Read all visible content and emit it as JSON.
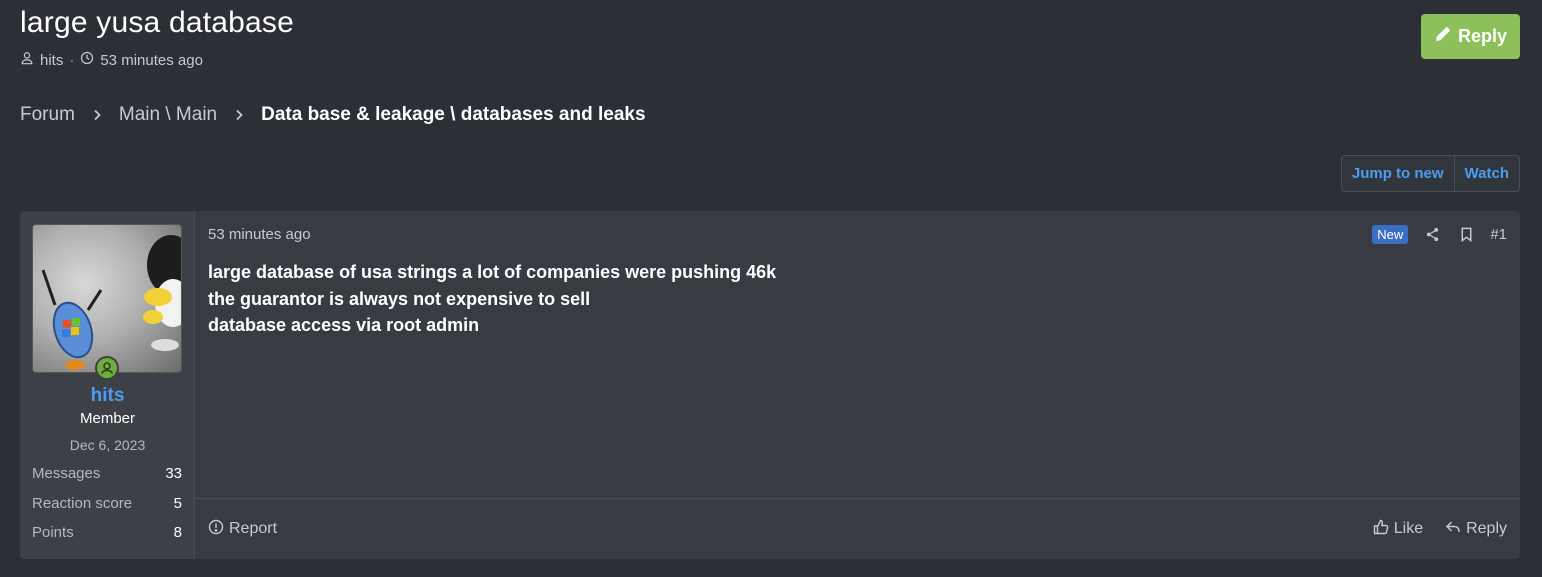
{
  "thread": {
    "title": "large yusa database",
    "author": "hits",
    "separator": "·",
    "time_ago": "53 minutes ago",
    "reply_label": "Reply"
  },
  "breadcrumb": {
    "items": [
      "Forum",
      "Main \\ Main"
    ],
    "current": "Data base & leakage \\ databases and leaks"
  },
  "thread_actions": {
    "jump_label": "Jump to new",
    "watch_label": "Watch"
  },
  "post": {
    "time_ago": "53 minutes ago",
    "badge": "New",
    "number": "#1",
    "lines": [
      "large database of usa strings a lot of companies were pushing 46k",
      "the guarantor is always not expensive to sell",
      "database access via root admin"
    ],
    "report_label": "Report",
    "like_label": "Like",
    "reply_label": "Reply"
  },
  "user": {
    "name": "hits",
    "title": "Member",
    "join_date": "Dec 6, 2023",
    "stats": [
      {
        "label": "Messages",
        "value": "33"
      },
      {
        "label": "Reaction score",
        "value": "5"
      },
      {
        "label": "Points",
        "value": "8"
      }
    ]
  },
  "colors": {
    "accent": "#4c9df0",
    "reply_button": "#8dc05a",
    "background": "#2c2f35",
    "badge": "#3a6fc4"
  },
  "icons": {
    "author": "user-icon",
    "time": "clock-icon",
    "reply": "pencil-icon",
    "share": "share-icon",
    "bookmark": "bookmark-icon",
    "online": "online-status-icon",
    "report": "alert-circle-icon",
    "like": "thumbs-up-icon",
    "reply_small": "reply-arrow-icon"
  }
}
